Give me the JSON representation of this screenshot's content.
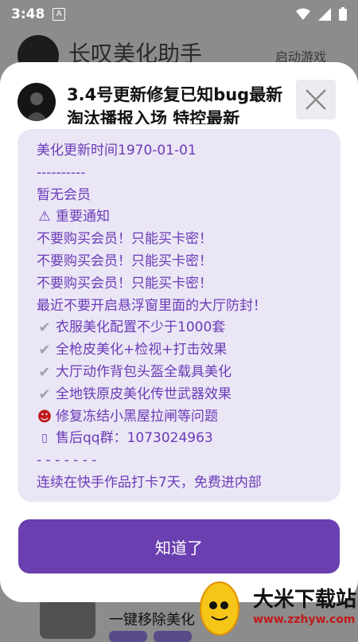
{
  "status": {
    "time": "3:48",
    "notif_icon": "A"
  },
  "background": {
    "app_title": "长叹美化助手",
    "launch_label": "启动游戏",
    "game_title": "一键移除美化"
  },
  "dialog": {
    "title": "3.4号更新修复已知bug最新淘汰播报入场 特控最新",
    "notice_lines": [
      {
        "icon": "",
        "text": "美化更新时间1970-01-01"
      },
      {
        "icon": "",
        "text": "----------"
      },
      {
        "icon": "",
        "text": "暂无会员"
      },
      {
        "icon": "warning",
        "text": "重要通知"
      },
      {
        "icon": "",
        "text": "不要购买会员！只能买卡密！"
      },
      {
        "icon": "",
        "text": "不要购买会员！只能买卡密！"
      },
      {
        "icon": "",
        "text": "不要购买会员！只能买卡密！"
      },
      {
        "icon": "",
        "text": "最近不要开启悬浮窗里面的大厅防封！"
      },
      {
        "icon": "check",
        "text": "衣服美化配置不少于1000套"
      },
      {
        "icon": "check",
        "text": "全枪皮美化+检视+打击效果"
      },
      {
        "icon": "check",
        "text": "大厅动作背包头盔全载具美化"
      },
      {
        "icon": "check",
        "text": "全地铁原皮美化传世武器效果"
      },
      {
        "icon": "devil",
        "text": "修复冻结小黑屋拉闸等问题"
      },
      {
        "icon": "box",
        "text": "售后qq群：1073024963"
      },
      {
        "icon": "",
        "text": "- - - - - - -"
      },
      {
        "icon": "",
        "text": "连续在快手作品打卡7天，免费进内部"
      }
    ],
    "ok_label": "知道了"
  },
  "watermark": {
    "name": "大米下载站",
    "url": "www.zzhyw.com"
  },
  "colors": {
    "accent": "#6a3fb0",
    "notice_text": "#6a3bb8",
    "notice_bg": "#ebe6f5"
  }
}
